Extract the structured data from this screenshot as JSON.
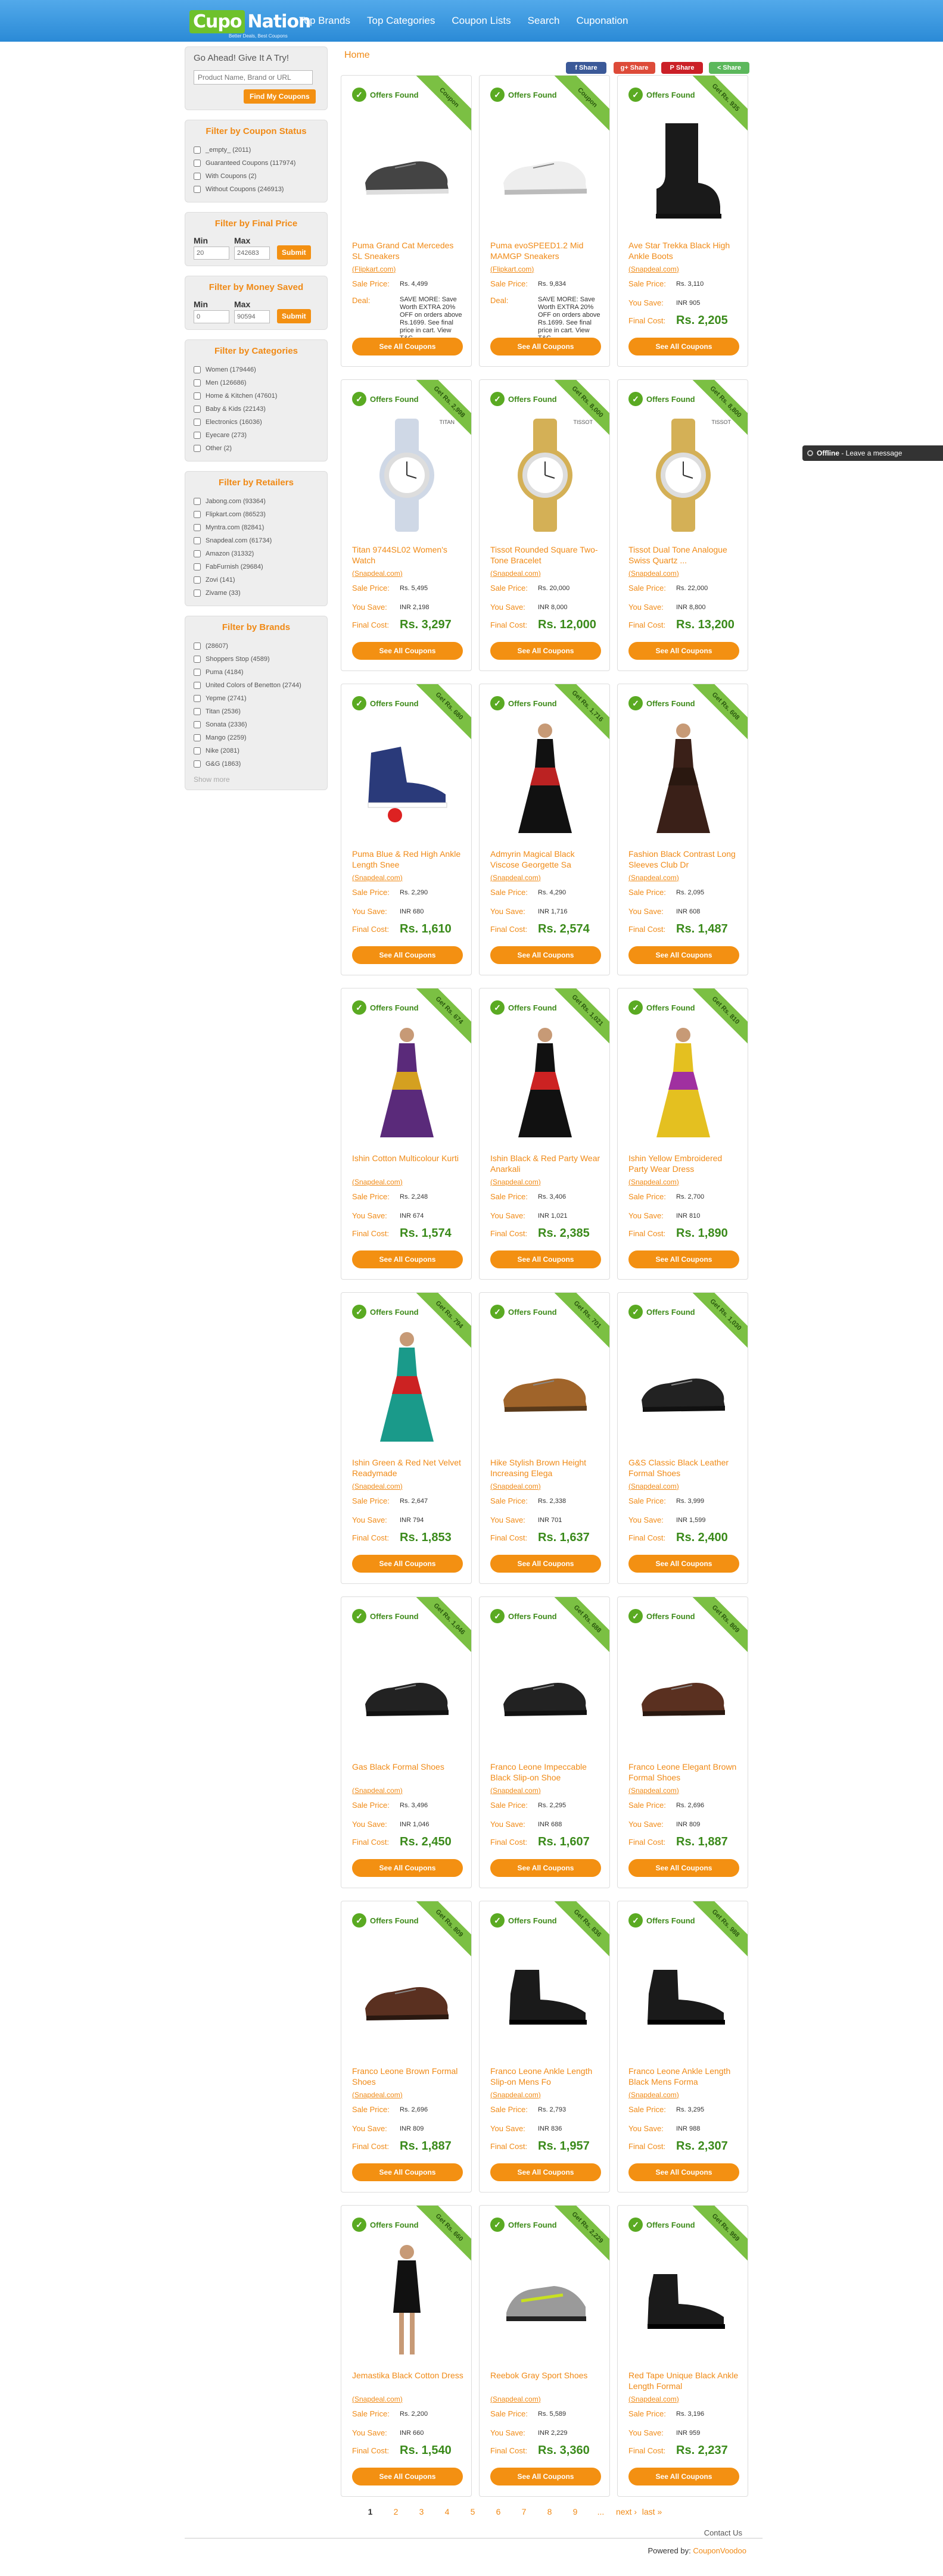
{
  "header": {
    "logo_part1": "Cupo",
    "logo_part2": "Nation",
    "logo_tagline": "Better Deals, Best Coupons",
    "nav": [
      "Top Brands",
      "Top Categories",
      "Coupon Lists",
      "Search",
      "Cuponation"
    ]
  },
  "sidebar": {
    "search": {
      "title": "Go Ahead! Give It A Try!",
      "placeholder": "Product Name, Brand or URL",
      "button": "Find My Coupons"
    },
    "coupon_status": {
      "title": "Filter by Coupon Status",
      "items": [
        "_empty_ (2011)",
        "Guaranteed Coupons (117974)",
        "With Coupons (2)",
        "Without Coupons (246913)"
      ]
    },
    "final_price": {
      "title": "Filter by Final Price",
      "min_label": "Min",
      "max_label": "Max",
      "min_value": "20",
      "max_value": "242683",
      "button": "Submit"
    },
    "money_saved": {
      "title": "Filter by Money Saved",
      "min_label": "Min",
      "max_label": "Max",
      "min_value": "0",
      "max_value": "90594",
      "button": "Submit"
    },
    "categories": {
      "title": "Filter by Categories",
      "items": [
        "Women (179446)",
        "Men (126686)",
        "Home & Kitchen (47601)",
        "Baby & Kids (22143)",
        "Electronics (16036)",
        "Eyecare (273)",
        "Other (2)"
      ]
    },
    "retailers": {
      "title": "Filter by Retailers",
      "items": [
        "Jabong.com (93364)",
        "Flipkart.com (86523)",
        "Myntra.com (82841)",
        "Snapdeal.com (61734)",
        "Amazon (31332)",
        "FabFurnish (29684)",
        "Zovi (141)",
        "Zivame (33)"
      ]
    },
    "brands": {
      "title": "Filter by Brands",
      "items": [
        "(28607)",
        "Shoppers Stop (4589)",
        "Puma (4184)",
        "United Colors of Benetton (2744)",
        "Yepme (2741)",
        "Titan (2536)",
        "Sonata (2336)",
        "Mango (2259)",
        "Nike (2081)",
        "G&G (1863)"
      ],
      "show_more": "Show more"
    }
  },
  "breadcrumb": "Home",
  "share": [
    "Share",
    "Share",
    "Share",
    "Share"
  ],
  "labels": {
    "offers_found": "Offers Found",
    "sale_price": "Sale Price:",
    "you_save": "You Save:",
    "final_cost": "Final Cost:",
    "deal": "Deal:",
    "see_all": "See All Coupons"
  },
  "products": [
    {
      "ribbon": "Coupon",
      "name": "Puma Grand Cat Mercedes SL Sneakers",
      "store": "Flipkart.com",
      "sale": "Rs. 4,499",
      "deal": "SAVE MORE: Save Worth EXTRA 20% OFF on orders above Rs.1699. See final price in cart. View T&C...",
      "img": "shoe"
    },
    {
      "ribbon": "Coupon",
      "name": "Puma evoSPEED1.2 Mid MAMGP Sneakers",
      "store": "Flipkart.com",
      "sale": "Rs. 9,834",
      "deal": "SAVE MORE: Save Worth EXTRA 20% OFF on orders above Rs.1699. See final price in cart. View T&C...",
      "img": "shoe-white"
    },
    {
      "ribbon": "Get Rs. 935",
      "name": "Ave Star Trekka Black High Ankle Boots",
      "store": "Snapdeal.com",
      "sale": "Rs. 3,110",
      "save": "INR 905",
      "final": "Rs. 2,205",
      "img": "boot"
    },
    {
      "ribbon": "Get Rs. 2,998",
      "name": "Titan 9744SL02 Women's Watch",
      "store": "Snapdeal.com",
      "sale": "Rs. 5,495",
      "save": "INR 2,198",
      "final": "Rs. 3,297",
      "img": "watch",
      "brand": "TITAN"
    },
    {
      "ribbon": "Get Rs. 8,000",
      "name": "Tissot Rounded Square Two-Tone Bracelet",
      "store": "Snapdeal.com",
      "sale": "Rs. 20,000",
      "save": "INR 8,000",
      "final": "Rs. 12,000",
      "img": "watch-gold",
      "brand": "TISSOT"
    },
    {
      "ribbon": "Get Rs. 8,800",
      "name": "Tissot Dual Tone Analogue Swiss Quartz ...",
      "store": "Snapdeal.com",
      "sale": "Rs. 22,000",
      "save": "INR 8,800",
      "final": "Rs. 13,200",
      "img": "watch-gold",
      "brand": "TISSOT"
    },
    {
      "ribbon": "Get Rs. 680",
      "name": "Puma Blue & Red High Ankle Length Snee",
      "store": "Snapdeal.com",
      "sale": "Rs. 2,290",
      "save": "INR 680",
      "final": "Rs. 1,610",
      "img": "sneaker-red"
    },
    {
      "ribbon": "Get Rs. 1,716",
      "name": "Admyrin Magical Black Viscose Georgette Sa",
      "store": "Snapdeal.com",
      "sale": "Rs. 4,290",
      "save": "INR 1,716",
      "final": "Rs. 2,574",
      "img": "dress-black"
    },
    {
      "ribbon": "Get Rs. 608",
      "name": "Fashion Black Contrast Long Sleeves Club Dr",
      "store": "Snapdeal.com",
      "sale": "Rs. 2,095",
      "save": "INR 608",
      "final": "Rs. 1,487",
      "img": "dress-dark"
    },
    {
      "ribbon": "Get Rs. 674",
      "name": "Ishin Cotton Multicolour Kurti",
      "store": "Snapdeal.com",
      "sale": "Rs. 2,248",
      "save": "INR 674",
      "final": "Rs. 1,574",
      "img": "dress-purple"
    },
    {
      "ribbon": "Get Rs. 1,021",
      "name": "Ishin Black & Red Party Wear Anarkali",
      "store": "Snapdeal.com",
      "sale": "Rs. 3,406",
      "save": "INR 1,021",
      "final": "Rs. 2,385",
      "img": "dress-red"
    },
    {
      "ribbon": "Get Rs. 810",
      "name": "Ishin Yellow Embroidered Party Wear Dress",
      "store": "Snapdeal.com",
      "sale": "Rs. 2,700",
      "save": "INR 810",
      "final": "Rs. 1,890",
      "img": "dress-yellow"
    },
    {
      "ribbon": "Get Rs. 794",
      "name": "Ishin Green & Red Net Velvet Readymade",
      "store": "Snapdeal.com",
      "sale": "Rs. 2,647",
      "save": "INR 794",
      "final": "Rs. 1,853",
      "img": "dress-green"
    },
    {
      "ribbon": "Get Rs. 701",
      "name": "Hike Stylish Brown Height Increasing Elega",
      "store": "Snapdeal.com",
      "sale": "Rs. 2,338",
      "save": "INR 701",
      "final": "Rs. 1,637",
      "img": "shoe-brown"
    },
    {
      "ribbon": "Get Rs. 1,030",
      "name": "G&S Classic Black Leather Formal Shoes",
      "store": "Snapdeal.com",
      "sale": "Rs. 3,999",
      "save": "INR 1,599",
      "final": "Rs. 2,400",
      "img": "shoe-black"
    },
    {
      "ribbon": "Get Rs. 1,046",
      "name": "Gas Black Formal Shoes",
      "store": "Snapdeal.com",
      "sale": "Rs. 3,496",
      "save": "INR 1,046",
      "final": "Rs. 2,450",
      "img": "shoe-black"
    },
    {
      "ribbon": "Get Rs. 688",
      "name": "Franco Leone Impeccable Black Slip-on Shoe",
      "store": "Snapdeal.com",
      "sale": "Rs. 2,295",
      "save": "INR 688",
      "final": "Rs. 1,607",
      "img": "shoe-black"
    },
    {
      "ribbon": "Get Rs. 809",
      "name": "Franco Leone Elegant Brown Formal Shoes",
      "store": "Snapdeal.com",
      "sale": "Rs. 2,696",
      "save": "INR 809",
      "final": "Rs. 1,887",
      "img": "shoe-brown2"
    },
    {
      "ribbon": "Get Rs. 809",
      "name": "Franco Leone Brown Formal Shoes",
      "store": "Snapdeal.com",
      "sale": "Rs. 2,696",
      "save": "INR 809",
      "final": "Rs. 1,887",
      "img": "shoe-brown2"
    },
    {
      "ribbon": "Get Rs. 836",
      "name": "Franco Leone Ankle Length Slip-on Mens Fo",
      "store": "Snapdeal.com",
      "sale": "Rs. 2,793",
      "save": "INR 836",
      "final": "Rs. 1,957",
      "img": "boot-ankle"
    },
    {
      "ribbon": "Get Rs. 988",
      "name": "Franco Leone Ankle Length Black Mens Forma",
      "store": "Snapdeal.com",
      "sale": "Rs. 3,295",
      "save": "INR 988",
      "final": "Rs. 2,307",
      "img": "boot-ankle"
    },
    {
      "ribbon": "Get Rs. 660",
      "name": "Jemastika Black Cotton Dress",
      "store": "Snapdeal.com",
      "sale": "Rs. 2,200",
      "save": "INR 660",
      "final": "Rs. 1,540",
      "img": "dress-short"
    },
    {
      "ribbon": "Get Rs. 2,229",
      "name": "Reebok Gray Sport Shoes",
      "store": "Snapdeal.com",
      "sale": "Rs. 5,589",
      "save": "INR 2,229",
      "final": "Rs. 3,360",
      "img": "sport"
    },
    {
      "ribbon": "Get Rs. 959",
      "name": "Red Tape Unique Black Ankle Length Formal",
      "store": "Snapdeal.com",
      "sale": "Rs. 3,196",
      "save": "INR 959",
      "final": "Rs. 2,237",
      "img": "boot-ankle"
    }
  ],
  "pager": [
    "1",
    "2",
    "3",
    "4",
    "5",
    "6",
    "7",
    "8",
    "9",
    "...",
    "next ›",
    "last »"
  ],
  "footer": {
    "contact": "Contact Us",
    "powered": "Powered by:",
    "powered_link": "CouponVoodoo"
  },
  "chat": {
    "status": "Offline",
    "text": "- Leave a message"
  },
  "colors": {
    "accent": "#f39012",
    "header": "#3399e0",
    "green": "#7bc043"
  }
}
